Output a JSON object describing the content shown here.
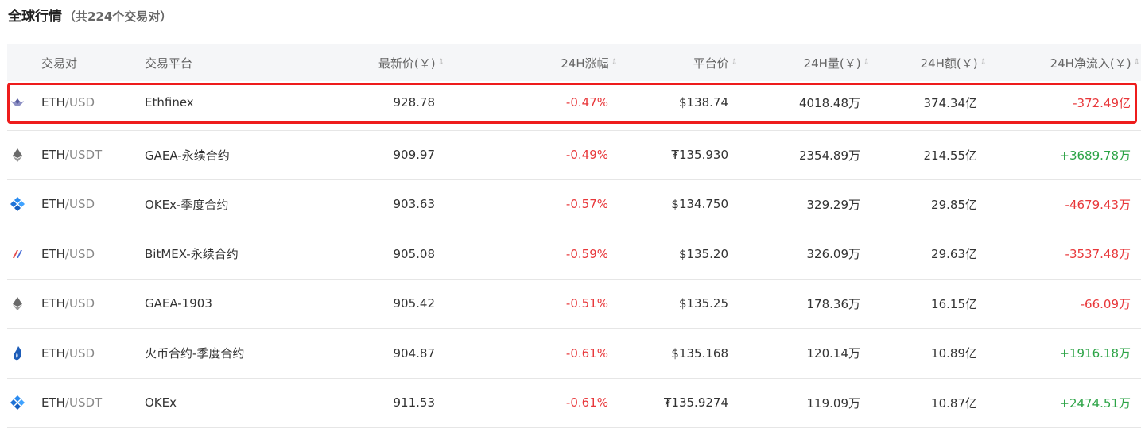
{
  "title": {
    "main": "全球行情",
    "count": "（共224个交易对）"
  },
  "columns": {
    "pair": "交易对",
    "exchange": "交易平台",
    "price": "最新价(￥)",
    "change": "24H涨幅",
    "platform_price": "平台价",
    "volume": "24H量(￥)",
    "amount": "24H额(￥)",
    "net_flow": "24H净流入(￥)"
  },
  "sort_icon": "⇕",
  "rows": [
    {
      "icon": "ethfinex-icon",
      "base": "ETH",
      "quote": "/USD",
      "exchange": "Ethfinex",
      "price": "928.78",
      "change": "-0.47%",
      "platform_price": "$138.74",
      "volume": "4018.48万",
      "amount": "374.34亿",
      "net_flow": "-372.49亿",
      "flow_sign": "neg"
    },
    {
      "icon": "gaea-icon",
      "base": "ETH",
      "quote": "/USDT",
      "exchange": "GAEA-永续合约",
      "price": "909.97",
      "change": "-0.49%",
      "platform_price": "₮135.930",
      "volume": "2354.89万",
      "amount": "214.55亿",
      "net_flow": "+3689.78万",
      "flow_sign": "pos"
    },
    {
      "icon": "okex-icon",
      "base": "ETH",
      "quote": "/USD",
      "exchange": "OKEx-季度合约",
      "price": "903.63",
      "change": "-0.57%",
      "platform_price": "$134.750",
      "volume": "329.29万",
      "amount": "29.85亿",
      "net_flow": "-4679.43万",
      "flow_sign": "neg"
    },
    {
      "icon": "bitmex-icon",
      "base": "ETH",
      "quote": "/USD",
      "exchange": "BitMEX-永续合约",
      "price": "905.08",
      "change": "-0.59%",
      "platform_price": "$135.20",
      "volume": "326.09万",
      "amount": "29.63亿",
      "net_flow": "-3537.48万",
      "flow_sign": "neg"
    },
    {
      "icon": "gaea-icon",
      "base": "ETH",
      "quote": "/USD",
      "exchange": "GAEA-1903",
      "price": "905.42",
      "change": "-0.51%",
      "platform_price": "$135.25",
      "volume": "178.36万",
      "amount": "16.15亿",
      "net_flow": "-66.09万",
      "flow_sign": "neg"
    },
    {
      "icon": "huobi-icon",
      "base": "ETH",
      "quote": "/USD",
      "exchange": "火币合约-季度合约",
      "price": "904.87",
      "change": "-0.61%",
      "platform_price": "$135.168",
      "volume": "120.14万",
      "amount": "10.89亿",
      "net_flow": "+1916.18万",
      "flow_sign": "pos"
    },
    {
      "icon": "okex-icon",
      "base": "ETH",
      "quote": "/USDT",
      "exchange": "OKEx",
      "price": "911.53",
      "change": "-0.61%",
      "platform_price": "₮135.9274",
      "volume": "119.09万",
      "amount": "10.87亿",
      "net_flow": "+2474.51万",
      "flow_sign": "pos"
    }
  ],
  "colors": {
    "negative": "#e8373a",
    "positive": "#2ba345",
    "highlight": "#ee1c1c",
    "header_bg": "#f5f6f8"
  }
}
